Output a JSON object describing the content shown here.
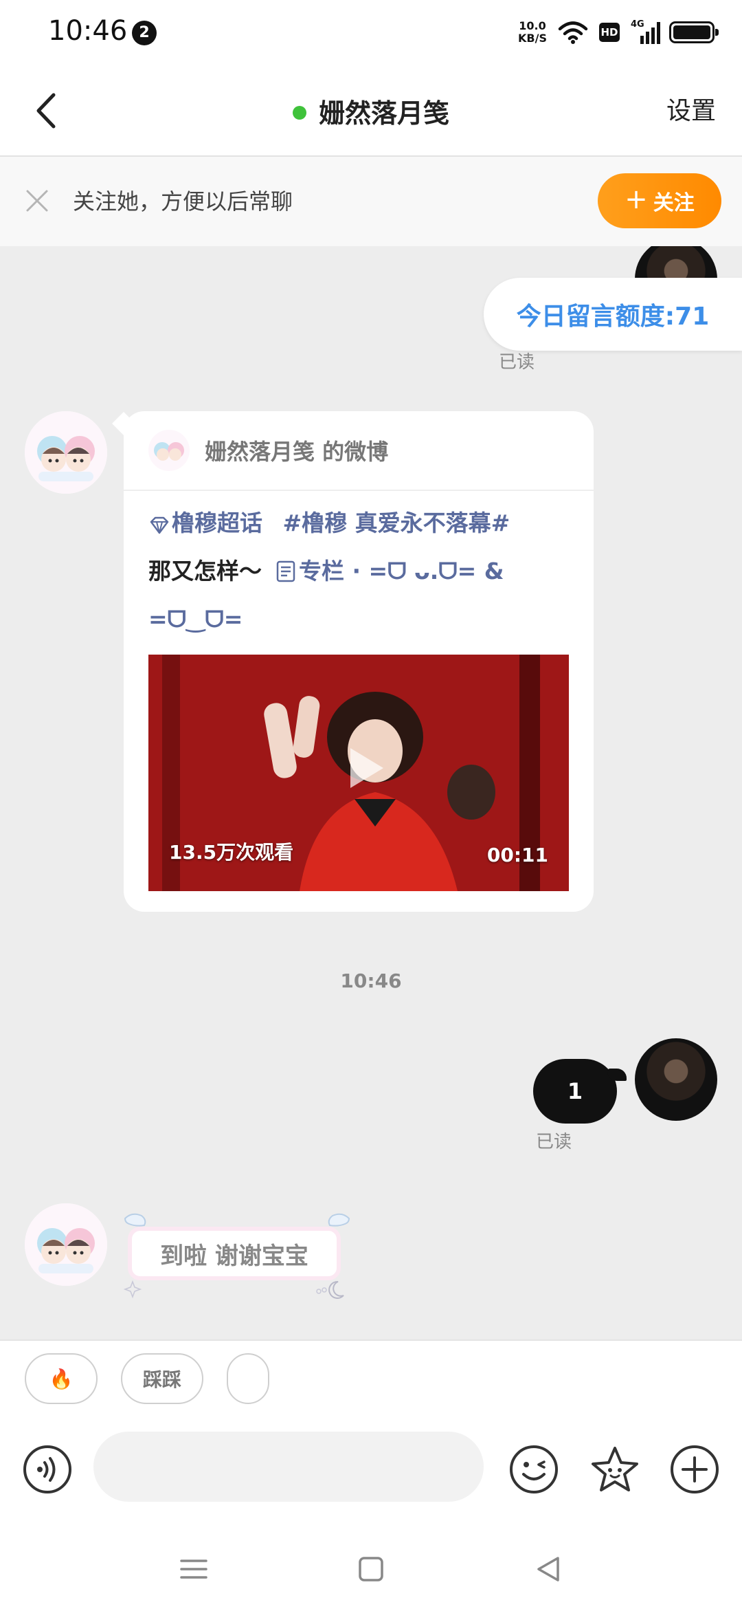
{
  "status_bar": {
    "time": "10:46",
    "notification_count": "2",
    "net_speed_value": "10.0",
    "net_speed_unit": "KB/S",
    "hd_label": "HD",
    "signal_label": "4G",
    "icons": [
      "wifi-icon",
      "hd-icon",
      "signal-4g-icon",
      "battery-icon"
    ]
  },
  "header": {
    "title": "姗然落月笺",
    "settings_label": "设置",
    "online_color": "#3fc23b"
  },
  "follow_bar": {
    "prompt": "关注她，方便以后常聊",
    "follow_label": "关注",
    "accent_color": "#ff9100"
  },
  "messages": {
    "quota_text": "今日留言额度:71",
    "read_label_1": "已读",
    "weibo_card": {
      "source": "姗然落月笺 的微博",
      "supertopic": "橹穆超话",
      "hashtag": "#橹穆 真爱永不落幕#",
      "text": "那又怎样～",
      "column_label": "专栏",
      "emoticon_1": "· =ᗜ ᴗ.ᗜ= &",
      "emoticon_2": "=ᗜ‿ᗜ=",
      "views": "13.5万次观看",
      "duration": "00:11"
    },
    "timestamp": "10:46",
    "sent_bubble": "1",
    "read_label_2": "已读",
    "received_text": "到啦 谢谢宝宝"
  },
  "quick_replies": [
    {
      "label": "🔥"
    },
    {
      "label": "踩踩"
    },
    {
      "label": ""
    }
  ],
  "input": {
    "value": "",
    "placeholder": ""
  }
}
